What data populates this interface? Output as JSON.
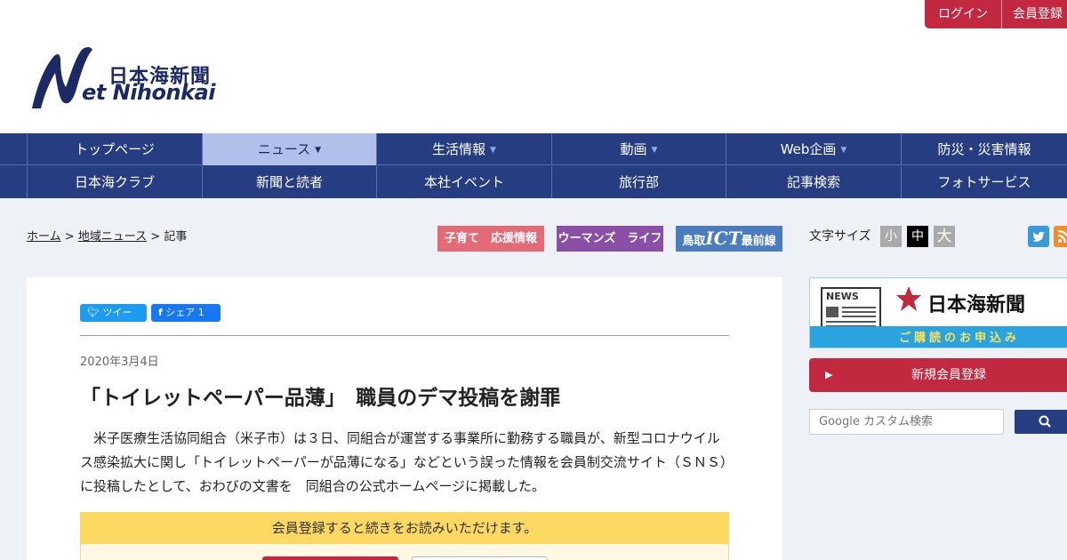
{
  "header": {
    "login": "ログイン",
    "register": "会員登録",
    "logo_jp": "日本海新聞",
    "logo_en": "et Nihonkai"
  },
  "nav": {
    "row1": [
      {
        "label": "トップページ",
        "arrow": ""
      },
      {
        "label": "ニュース",
        "arrow": "▼",
        "active": true
      },
      {
        "label": "生活情報",
        "arrow": "▼"
      },
      {
        "label": "動画",
        "arrow": "▼"
      },
      {
        "label": "Web企画",
        "arrow": "▼"
      },
      {
        "label": "防災・災害情報",
        "arrow": ""
      }
    ],
    "row2": [
      {
        "label": "日本海クラブ"
      },
      {
        "label": "新聞と読者"
      },
      {
        "label": "本社イベント"
      },
      {
        "label": "旅行部"
      },
      {
        "label": "記事検索"
      },
      {
        "label": "フォトサービス"
      }
    ]
  },
  "breadcrumb": {
    "home": "ホーム",
    "sep1": " > ",
    "local": "地域ニュース",
    "sep2": " > ",
    "current": "記事"
  },
  "banners": {
    "b1": "子育て　応援情報",
    "b2": "ウーマンズ　ライフ",
    "b3_pre": "鳥取",
    "b3_ict": "ICT",
    "b3_post": "最前線"
  },
  "font_size": {
    "label": "文字サイズ",
    "small": "小",
    "medium": "中",
    "large": "大"
  },
  "article": {
    "tweet": "ツイート",
    "share": "シェア 1",
    "date": "2020年3月4日",
    "title": "「トイレットペーパー品薄」　職員のデマ投稿を謝罪",
    "body": "　米子医療生活協同組合（米子市）は３日、同組合が運営する事業所に勤務する職員が、新型コロナウイルス感染拡大に関し「トイレットペーパーが品薄になる」などという誤った情報を会員制交流サイト（ＳＮＳ）に投稿したとして、おわびの文書を　同組合の公式ホームページに掲載した。",
    "notice": "会員登録すると続きをお読みいただけます。"
  },
  "sidebar": {
    "ad_news": "NEWS",
    "ad_title": "日本海新聞",
    "ad_sub": "ご購読のお申込み",
    "register_button": "新規会員登録",
    "search_placeholder": "Google カスタム検索"
  },
  "colors": {
    "accent_red": "#c2283f",
    "nav_blue": "#263d82",
    "nav_active": "#b1c0ea"
  }
}
